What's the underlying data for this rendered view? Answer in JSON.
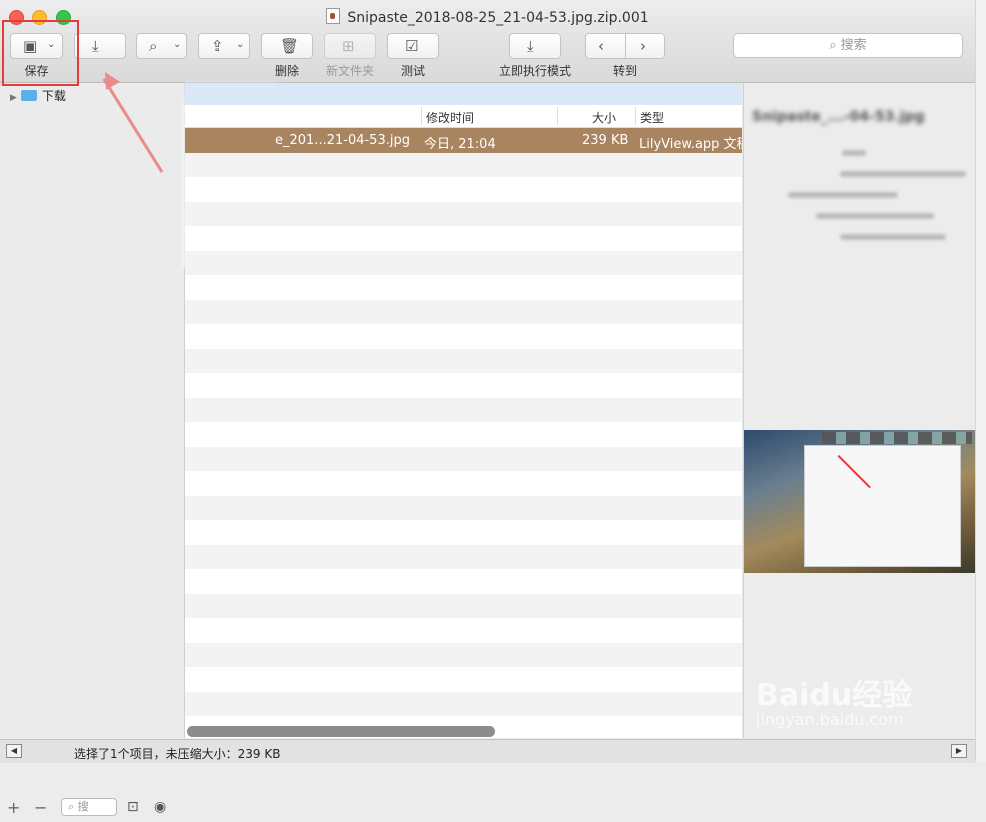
{
  "window": {
    "title": "Snipaste_2018-08-25_21-04-53.jpg.zip.001"
  },
  "toolbar": {
    "save_label": "保存",
    "extract_label": "",
    "view_label": "",
    "share_label": "",
    "delete_label": "删除",
    "new_folder_label": "新文件夹",
    "test_label": "测试",
    "run_now_label": "立即执行模式",
    "goto_label": "转到",
    "search_placeholder": "搜索"
  },
  "sidebar": {
    "items": [
      {
        "label": "下载",
        "icon": "folder-icon"
      }
    ],
    "search_placeholder": "搜"
  },
  "file_list": {
    "columns": {
      "modified": "修改时间",
      "size": "大小",
      "kind": "类型"
    },
    "rows": [
      {
        "name": "e_201...21-04-53.jpg",
        "modified": "今日, 21:04",
        "size": "239 KB",
        "kind": "LilyView.app 文稿"
      }
    ]
  },
  "preview": {
    "title": "Snipaste_...-04-53.jpg"
  },
  "status_bar": {
    "text": "选择了1个项目，未压缩大小：239 KB"
  },
  "watermark": {
    "main": "Baidu经验",
    "sub": "jingyan.baidu.com"
  },
  "colors": {
    "selection": "#a88461",
    "highlight_box": "#e43b3b"
  }
}
